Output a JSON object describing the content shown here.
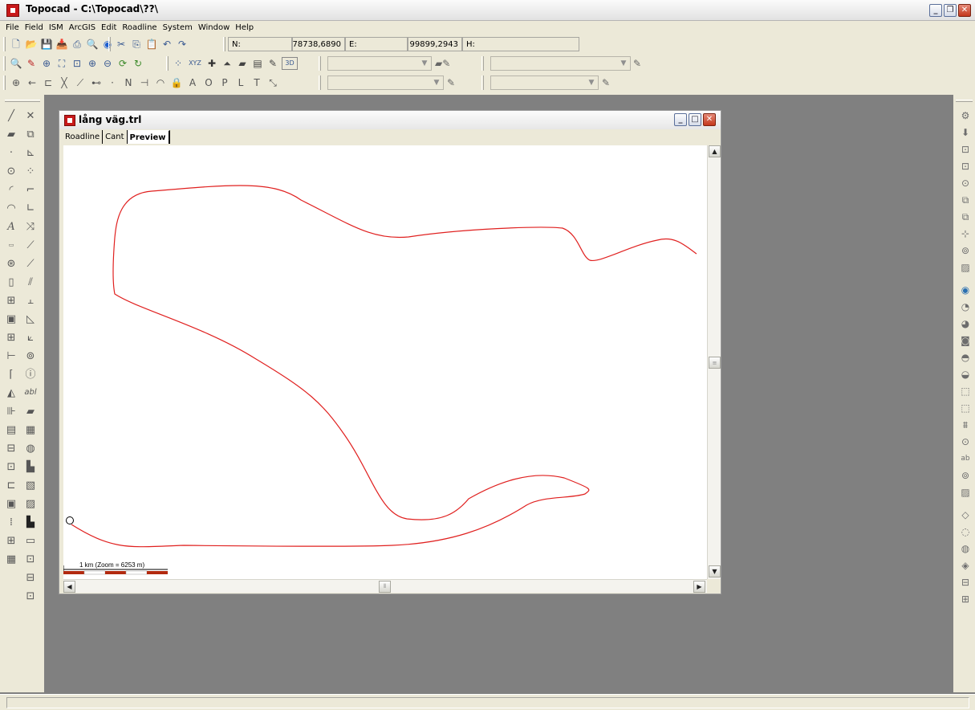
{
  "app": {
    "title": "Topocad - C:\\Topocad\\??\\"
  },
  "menu": [
    "File",
    "Field",
    "ISM",
    "ArcGIS",
    "Edit",
    "Roadline",
    "System",
    "Window",
    "Help"
  ],
  "coords": {
    "n_label": "N:",
    "n_value": "78738,6890",
    "e_label": "E:",
    "e_value": "99899,2943",
    "h_label": "H:",
    "h_value": ""
  },
  "toolbar_text": {
    "xyz": "XYZ",
    "threed": "3D",
    "point_codes": [
      "N",
      "A",
      "O",
      "P",
      "L",
      "T"
    ]
  },
  "child": {
    "title": "lång väg.trl",
    "tabs": [
      "Roadline",
      "Cant",
      "Preview"
    ],
    "active_tab": "Preview"
  },
  "preview": {
    "scale_text": "1 km  (Zoom = 6253 m)",
    "line_color": "#e0201f"
  },
  "colors": {
    "chrome": "#ece9d8",
    "workspace": "#808080",
    "app_icon": "#c8191b"
  }
}
